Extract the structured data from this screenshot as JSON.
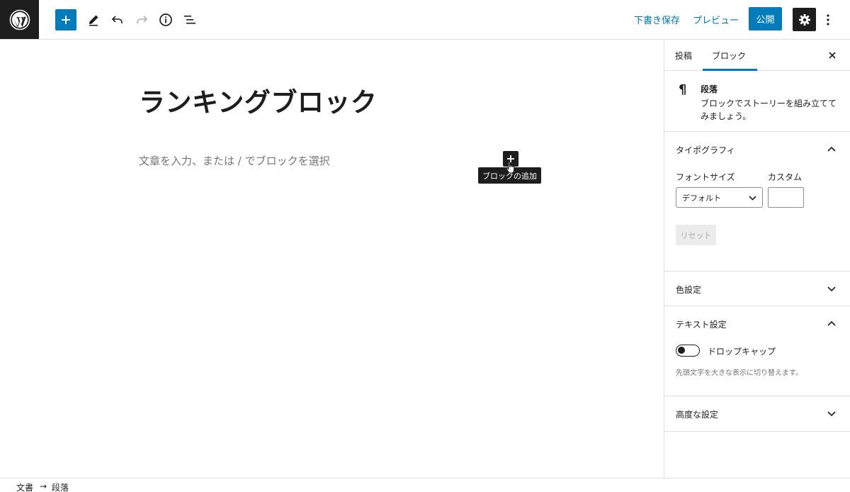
{
  "toolbar": {
    "save_draft": "下書き保存",
    "preview": "プレビュー",
    "publish": "公開"
  },
  "editor": {
    "title": "ランキングブロック",
    "placeholder": "文章を入力、または / でブロックを選択",
    "inserter_tooltip": "ブロックの追加"
  },
  "sidebar": {
    "tabs": [
      "投稿",
      "ブロック"
    ],
    "active_tab": "ブロック",
    "block": {
      "name": "段落",
      "description": "ブロックでストーリーを組み立ててみましょう。"
    },
    "typography": {
      "title": "タイポグラフィ",
      "font_size_label": "フォントサイズ",
      "custom_label": "カスタム",
      "font_size_value": "デフォルト",
      "reset_label": "リセット"
    },
    "color_settings": {
      "title": "色設定"
    },
    "text_settings": {
      "title": "テキスト設定",
      "drop_cap_label": "ドロップキャップ",
      "drop_cap_help": "先頭文字を大きな表示に切り替えます。",
      "drop_cap_enabled": false
    },
    "advanced": {
      "title": "高度な設定"
    }
  },
  "breadcrumb": {
    "items": [
      "文書",
      "段落"
    ],
    "separator": "→"
  },
  "colors": {
    "accent": "#007cba",
    "dark": "#1e1e1e",
    "border": "#e0e0e0"
  }
}
